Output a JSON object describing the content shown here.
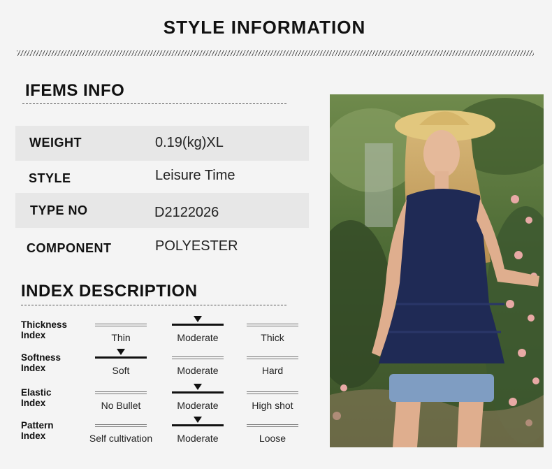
{
  "header": {
    "title": "STYLE INFORMATION"
  },
  "items_info": {
    "title": "IFEMS INFO",
    "rows": [
      {
        "label": "WEIGHT",
        "value": "0.19(kg)XL"
      },
      {
        "label": "STYLE",
        "value": "Leisure Time"
      },
      {
        "label": "TYPE NO",
        "value": "D2122026"
      },
      {
        "label": "COMPONENT",
        "value": "POLYESTER"
      }
    ]
  },
  "index_description": {
    "title": "INDEX DESCRIPTION",
    "indices": [
      {
        "label_line1": "Thickness",
        "label_line2": "Index",
        "options": [
          "Thin",
          "Moderate",
          "Thick"
        ],
        "selected": 1
      },
      {
        "label_line1": "Softness",
        "label_line2": "Index",
        "options": [
          "Soft",
          "Moderate",
          "Hard"
        ],
        "selected": 0
      },
      {
        "label_line1": "Elastic",
        "label_line2": "Index",
        "options": [
          "No Bullet",
          "Moderate",
          "High shot"
        ],
        "selected": 1
      },
      {
        "label_line1": "Pattern",
        "label_line2": "Index",
        "options": [
          "Self cultivation",
          "Moderate",
          "Loose"
        ],
        "selected": 1
      }
    ]
  },
  "colors": {
    "top_navy": "#1f2a55",
    "hat": "#e2c77e",
    "shorts": "#7f9dc2",
    "foliage": "#4f6b39"
  }
}
